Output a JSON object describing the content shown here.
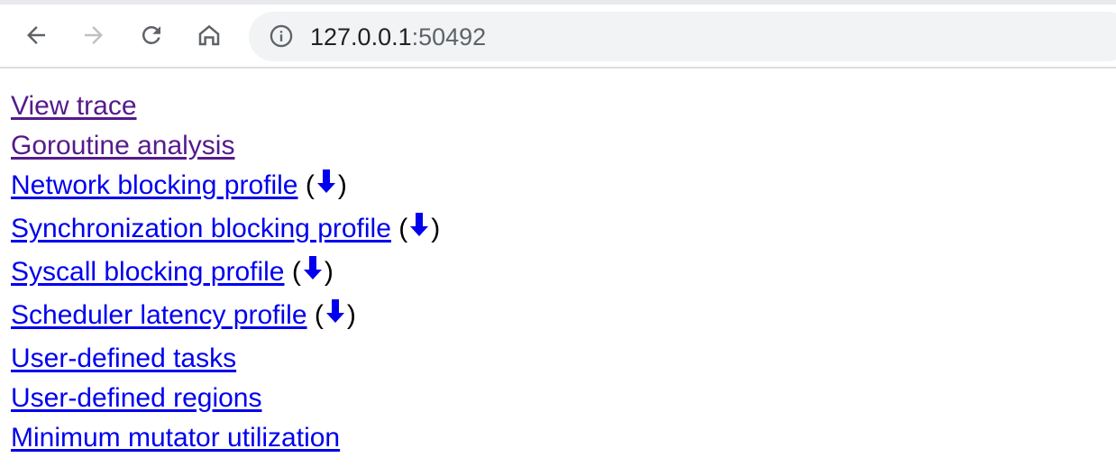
{
  "browser": {
    "url_host": "127.0.0.1",
    "url_port": ":50492",
    "icons": {
      "back": "arrow-left-icon",
      "forward": "arrow-right-icon",
      "reload": "reload-icon",
      "home": "home-icon",
      "site_info": "info-icon"
    }
  },
  "links": [
    {
      "label": "View trace",
      "visited": true,
      "download": false
    },
    {
      "label": "Goroutine analysis",
      "visited": true,
      "download": false
    },
    {
      "label": "Network blocking profile",
      "visited": false,
      "download": true
    },
    {
      "label": "Synchronization blocking profile",
      "visited": false,
      "download": true
    },
    {
      "label": "Syscall blocking profile",
      "visited": false,
      "download": true
    },
    {
      "label": "Scheduler latency profile",
      "visited": false,
      "download": true
    },
    {
      "label": "User-defined tasks",
      "visited": false,
      "download": false
    },
    {
      "label": "User-defined regions",
      "visited": false,
      "download": false
    },
    {
      "label": "Minimum mutator utilization",
      "visited": false,
      "download": false
    }
  ],
  "paren_open": "(",
  "paren_close": ")",
  "colors": {
    "link": "#0000ee",
    "visited": "#551a8b",
    "download_arrow": "#0000ee"
  }
}
